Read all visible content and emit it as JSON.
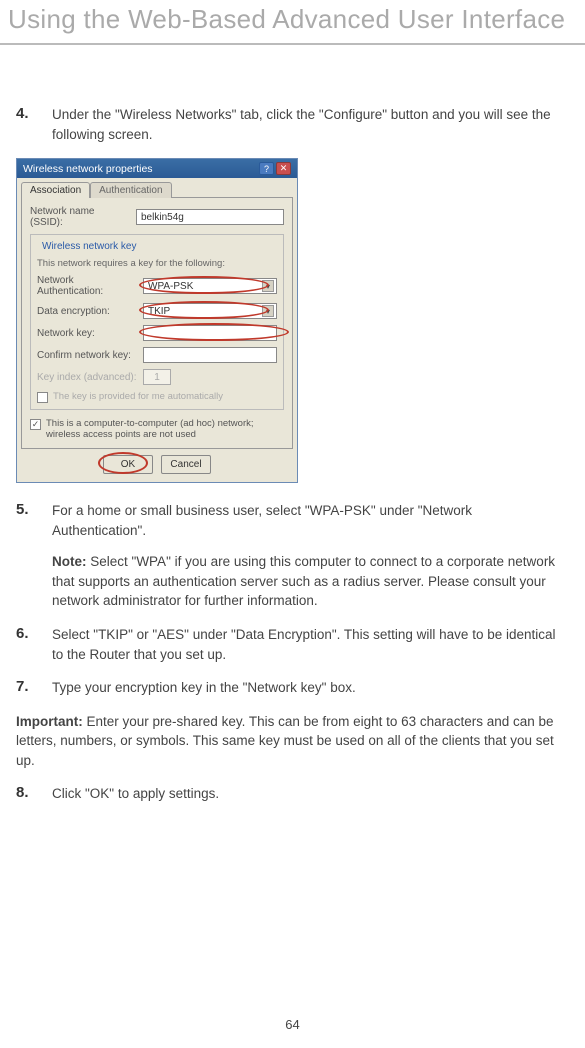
{
  "page_title": "Using the Web-Based Advanced User Interface",
  "page_number": "64",
  "steps": {
    "s4": {
      "num": "4.",
      "text": "Under the \"Wireless Networks\" tab, click the \"Configure\" button and you will see the following screen."
    },
    "s5": {
      "num": "5.",
      "text": "For a home or small business user, select \"WPA-PSK\" under \"Network Authentication\".",
      "note_label": "Note:",
      "note_text": " Select \"WPA\" if you are using this computer to connect to a corporate network that supports an authentication server such as a radius server. Please consult your network administrator for further information."
    },
    "s6": {
      "num": "6.",
      "text": "Select \"TKIP\" or \"AES\" under \"Data Encryption\". This setting will have to be identical to the Router that you set up."
    },
    "s7": {
      "num": "7.",
      "text": "Type your encryption key in the \"Network key\" box."
    },
    "s8": {
      "num": "8.",
      "text": "Click \"OK\" to apply settings."
    }
  },
  "important": {
    "label": "Important:",
    "text": " Enter your pre-shared key. This can be from eight to 63 characters and can be letters, numbers, or symbols. This same key must be used on all of the clients that you set up."
  },
  "dialog": {
    "title": "Wireless network properties",
    "tabs": {
      "assoc": "Association",
      "auth": "Authentication"
    },
    "ssid_label": "Network name (SSID):",
    "ssid_value": "belkin54g",
    "group_title": "Wireless network key",
    "hint": "This network requires a key for the following:",
    "auth_label": "Network Authentication:",
    "auth_value": "WPA-PSK",
    "enc_label": "Data encryption:",
    "enc_value": "TKIP",
    "key_label": "Network key:",
    "confirm_label": "Confirm network key:",
    "index_label": "Key index (advanced):",
    "index_value": "1",
    "auto_check": "The key is provided for me automatically",
    "adhoc_check": "This is a computer-to-computer (ad hoc) network; wireless access points are not used",
    "ok": "OK",
    "cancel": "Cancel"
  }
}
